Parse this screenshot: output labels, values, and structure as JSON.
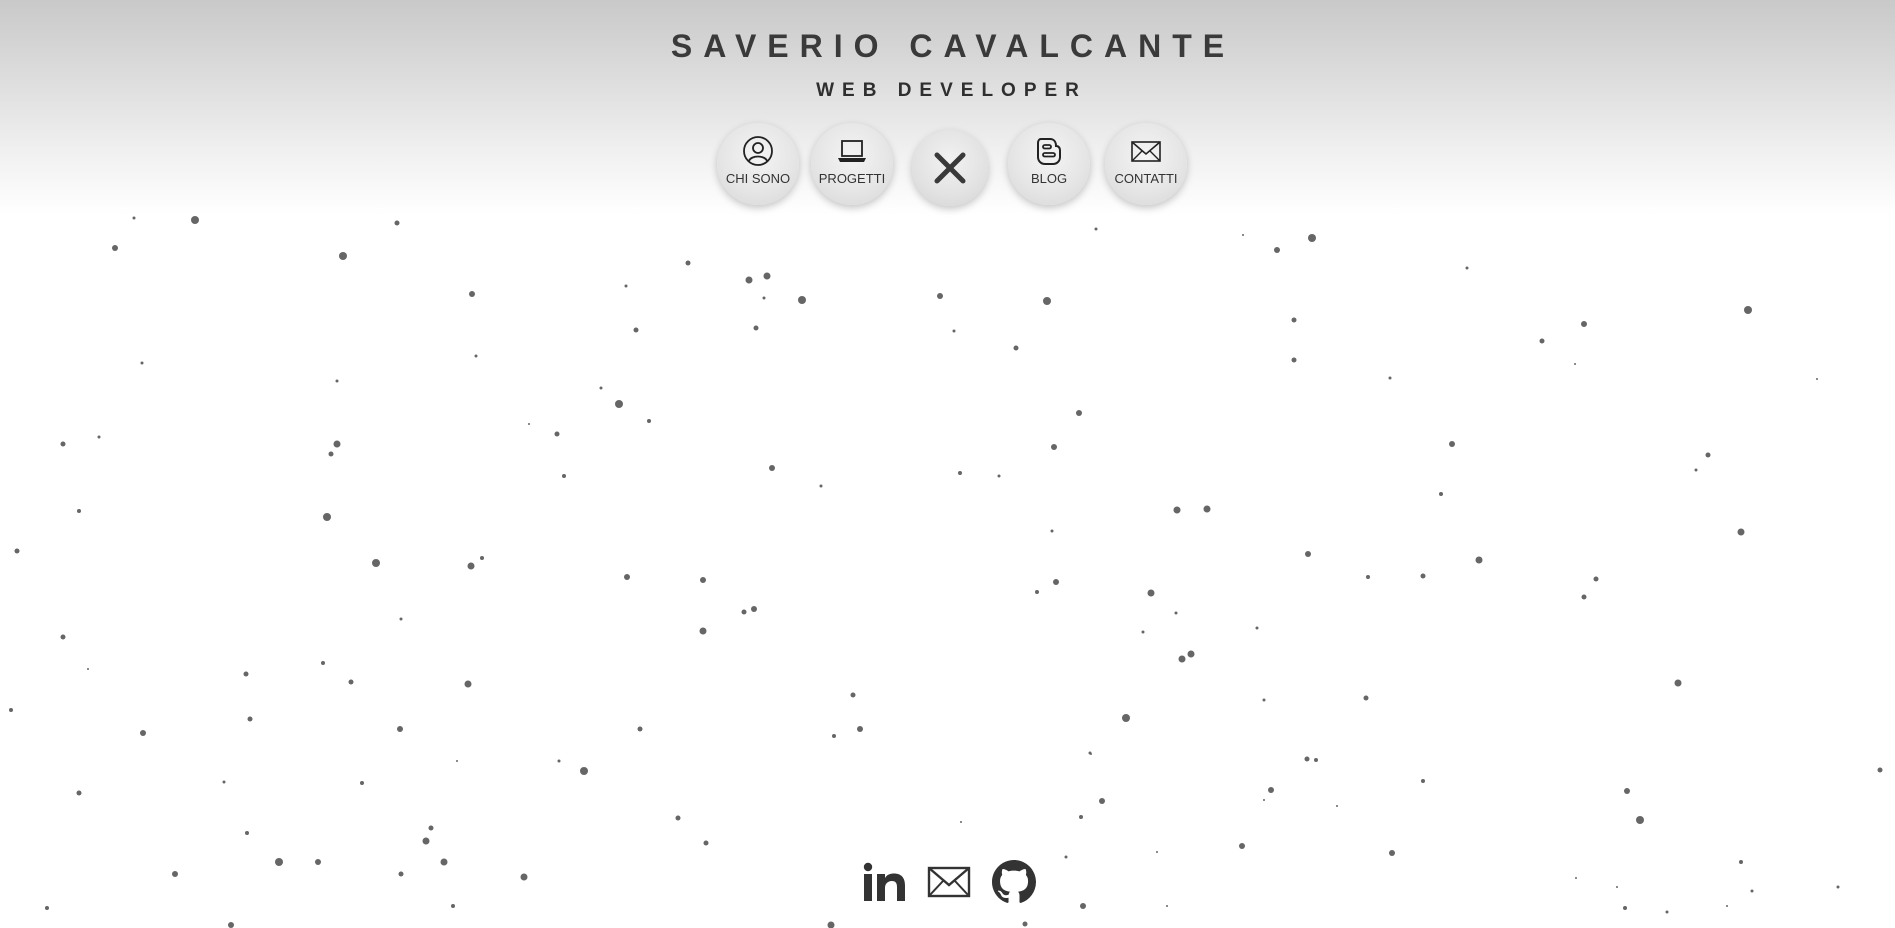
{
  "header": {
    "name": "SAVERIO CAVALCANTE",
    "role": "WEB DEVELOPER"
  },
  "nav": {
    "items": [
      {
        "label": "CHI SONO",
        "icon": "user-circle-icon"
      },
      {
        "label": "PROGETTI",
        "icon": "laptop-icon"
      },
      {
        "label": "BLOG",
        "icon": "blogger-icon"
      },
      {
        "label": "CONTATTI",
        "icon": "envelope-icon"
      }
    ],
    "close_icon": "close-icon"
  },
  "social": {
    "links": [
      {
        "icon": "linkedin-icon"
      },
      {
        "icon": "envelope-icon"
      },
      {
        "icon": "github-icon"
      }
    ]
  },
  "colors": {
    "header_gradient_top": "#c9c9c9",
    "text": "#333333",
    "particles": "#666666",
    "background": "#ffffff"
  }
}
